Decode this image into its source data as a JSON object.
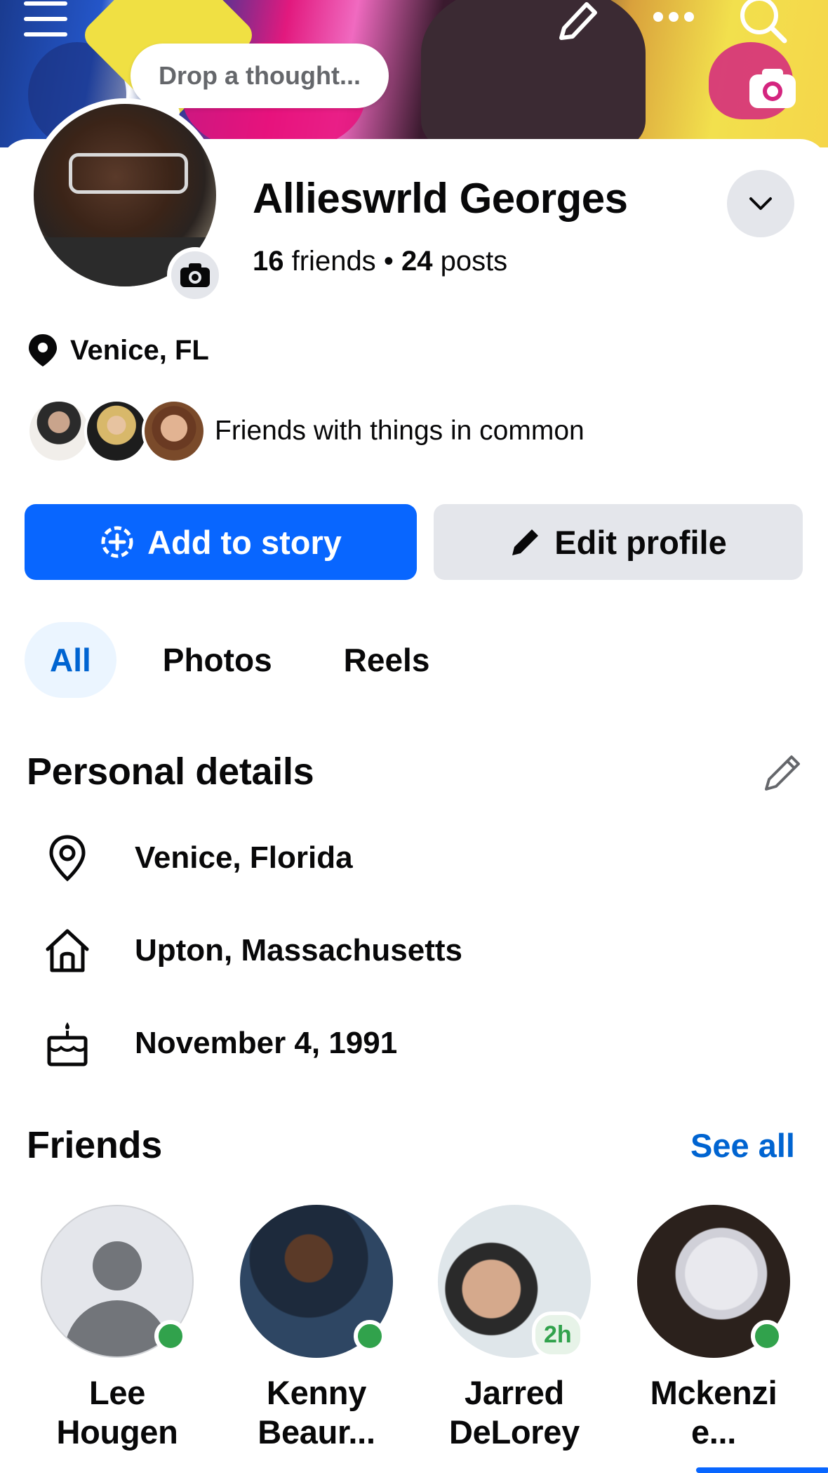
{
  "header": {
    "thought_placeholder": "Drop a thought..."
  },
  "profile": {
    "name": "Allieswrld Georges",
    "friends_count": "16",
    "friends_label": "friends",
    "separator": "•",
    "posts_count": "24",
    "posts_label": "posts",
    "location": "Venice, FL",
    "mutual_text": "Friends with things in common"
  },
  "actions": {
    "add_to_story": "Add to story",
    "edit_profile": "Edit profile"
  },
  "tabs": [
    {
      "label": "All",
      "active": true
    },
    {
      "label": "Photos",
      "active": false
    },
    {
      "label": "Reels",
      "active": false
    }
  ],
  "personal_details": {
    "title": "Personal details",
    "items": [
      {
        "icon": "location-pin-icon",
        "text": "Venice, Florida"
      },
      {
        "icon": "home-icon",
        "text": "Upton, Massachusetts"
      },
      {
        "icon": "birthday-cake-icon",
        "text": "November 4, 1991"
      }
    ]
  },
  "friends": {
    "title": "Friends",
    "see_all": "See all",
    "items": [
      {
        "line1": "Lee",
        "line2": "Hougen",
        "status": "online"
      },
      {
        "line1": "Kenny",
        "line2": "Beaur...",
        "status": "online"
      },
      {
        "line1": "Jarred",
        "line2": "DeLorey",
        "status": "2h"
      },
      {
        "line1": "Mckenzi",
        "line2": "e...",
        "status": "online"
      }
    ]
  },
  "colors": {
    "primary_blue": "#0866ff",
    "link_blue": "#0064d1",
    "secondary_button": "#e4e6eb",
    "online_green": "#31a24c"
  }
}
